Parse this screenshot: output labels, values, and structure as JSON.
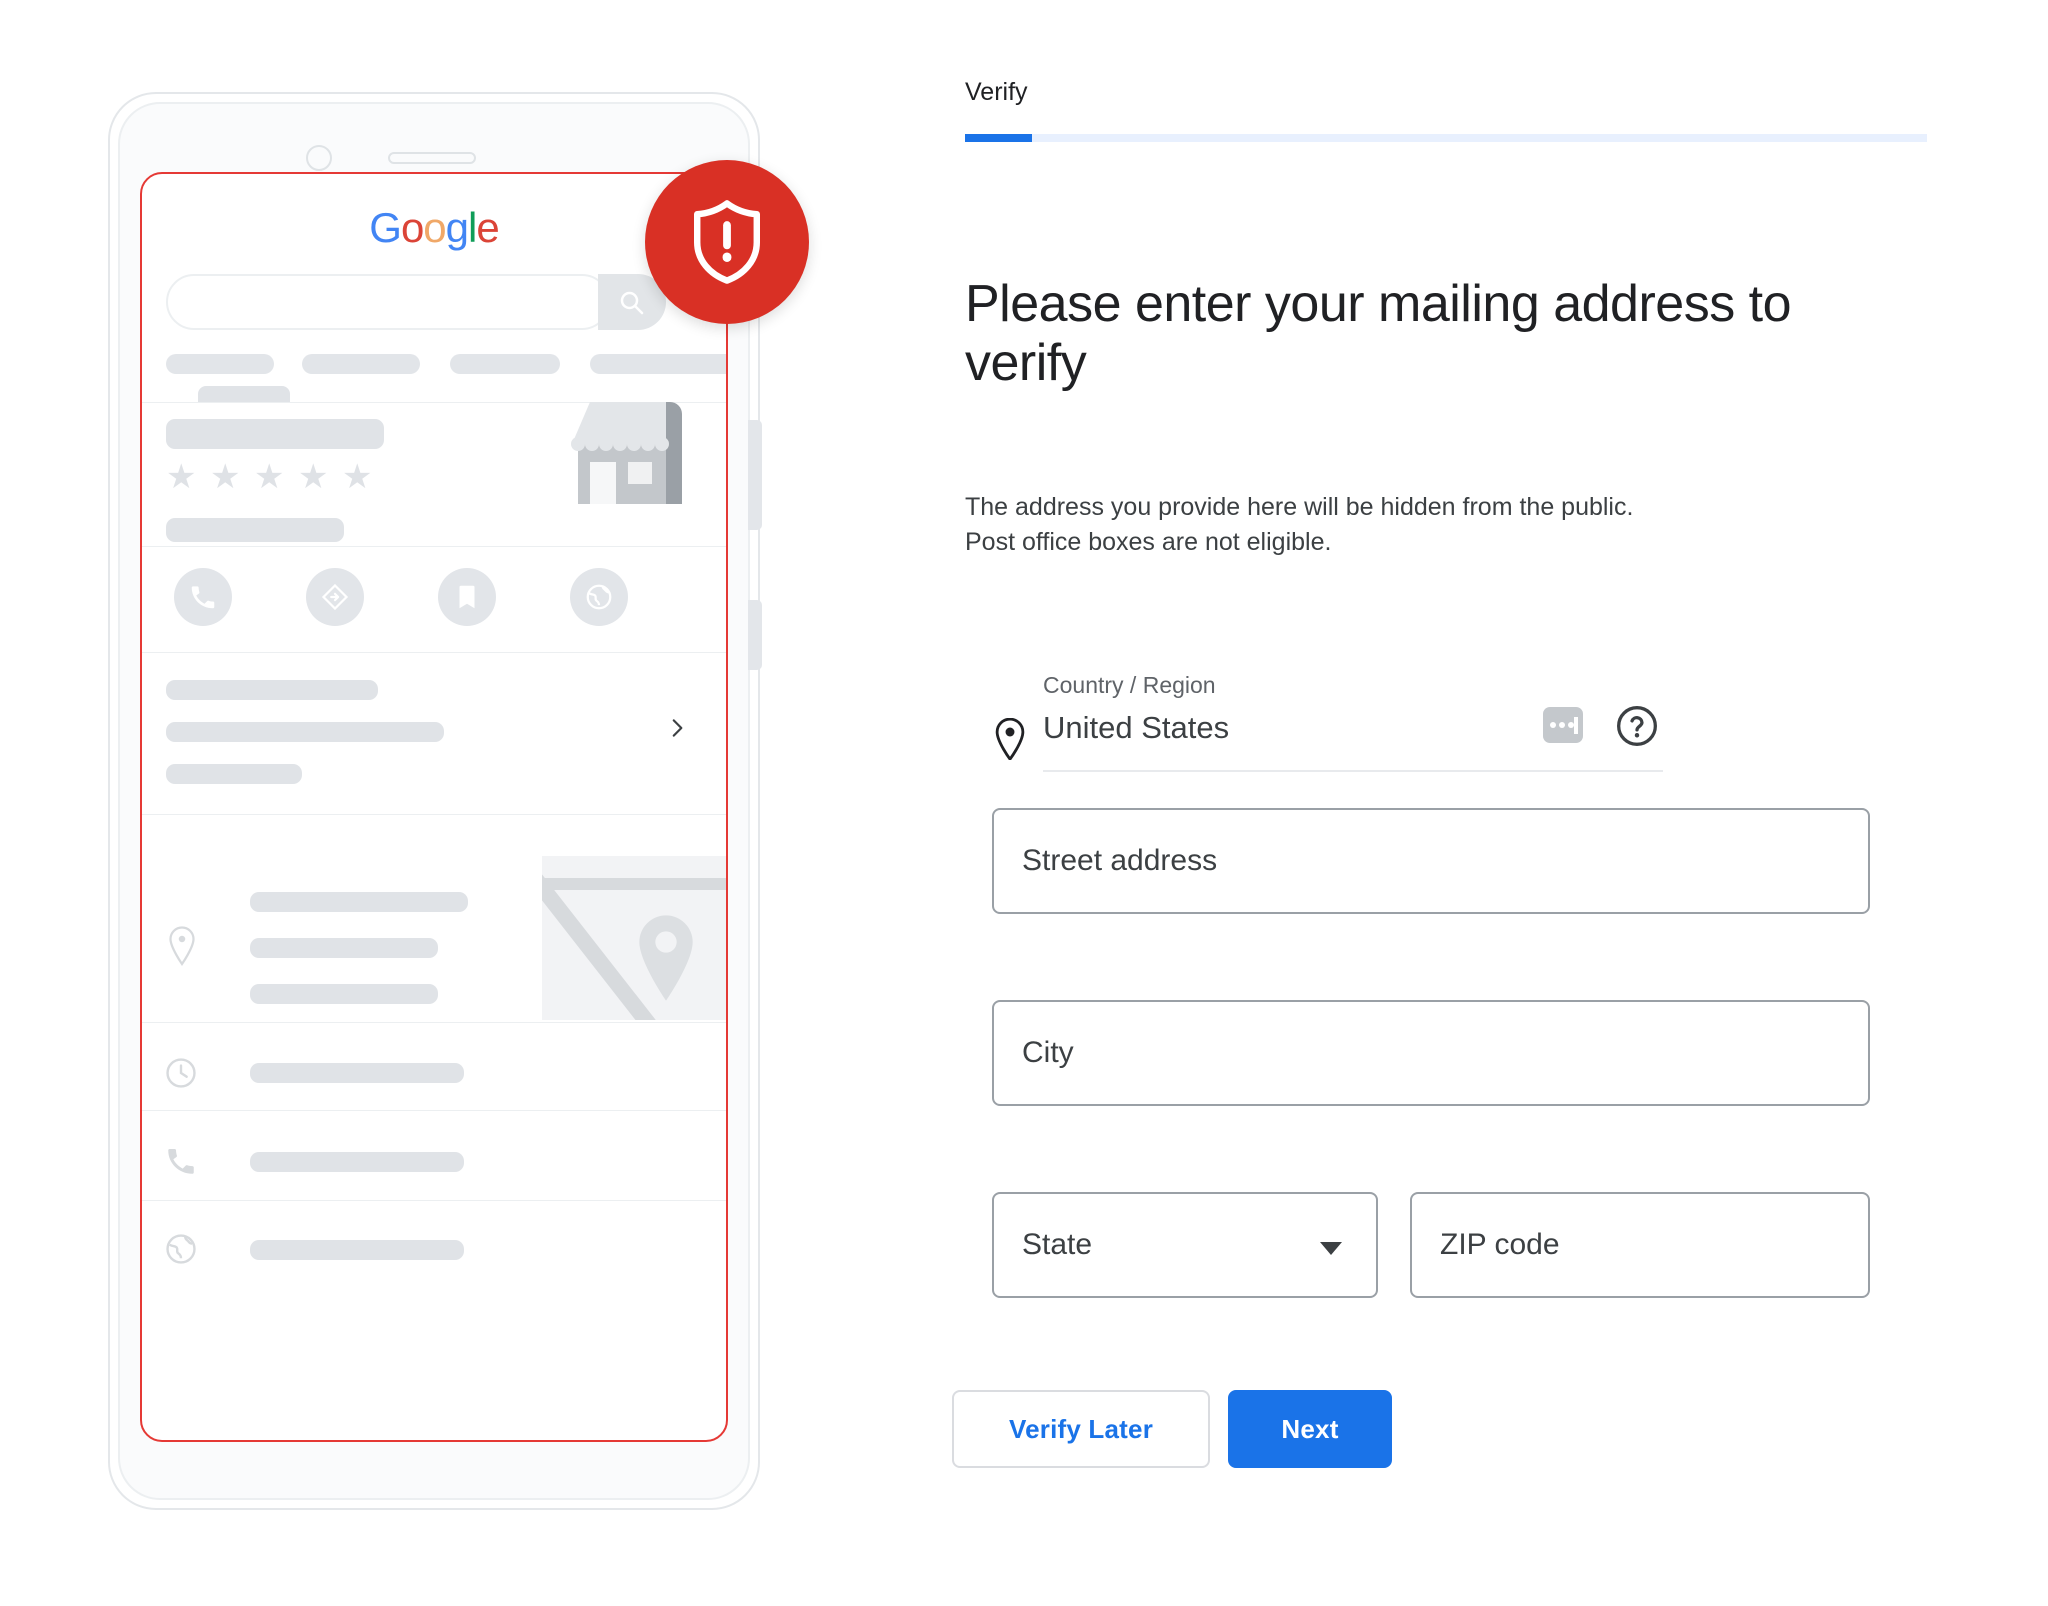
{
  "step": {
    "label": "Verify",
    "progress_percent": 7
  },
  "headline": "Please enter your mailing address to verify",
  "subtext": "The address you provide here will be hidden from the public. Post office boxes are not eligible.",
  "country": {
    "label": "Country / Region",
    "value": "United States"
  },
  "fields": {
    "street": "Street address",
    "city": "City",
    "state": "State",
    "zip": "ZIP code"
  },
  "buttons": {
    "verify_later": "Verify Later",
    "next": "Next"
  },
  "phone_mockup": {
    "logo": {
      "g1": "G",
      "o1": "o",
      "o2": "o",
      "g2": "g",
      "l": "l",
      "e": "e"
    }
  },
  "colors": {
    "accent_blue": "#1a73e8",
    "progress_track": "#e8f0fe",
    "alert_red": "#D93025",
    "screen_outline_red": "#e53935",
    "placeholder_gray": "#e0e3e7",
    "text_primary": "#202124",
    "text_secondary": "#5f6368",
    "field_border": "#9aa0a6",
    "google_blue": "#4285F4",
    "google_red": "#DB4437",
    "google_yellow": "#F0A868",
    "google_green": "#0F9D58"
  }
}
